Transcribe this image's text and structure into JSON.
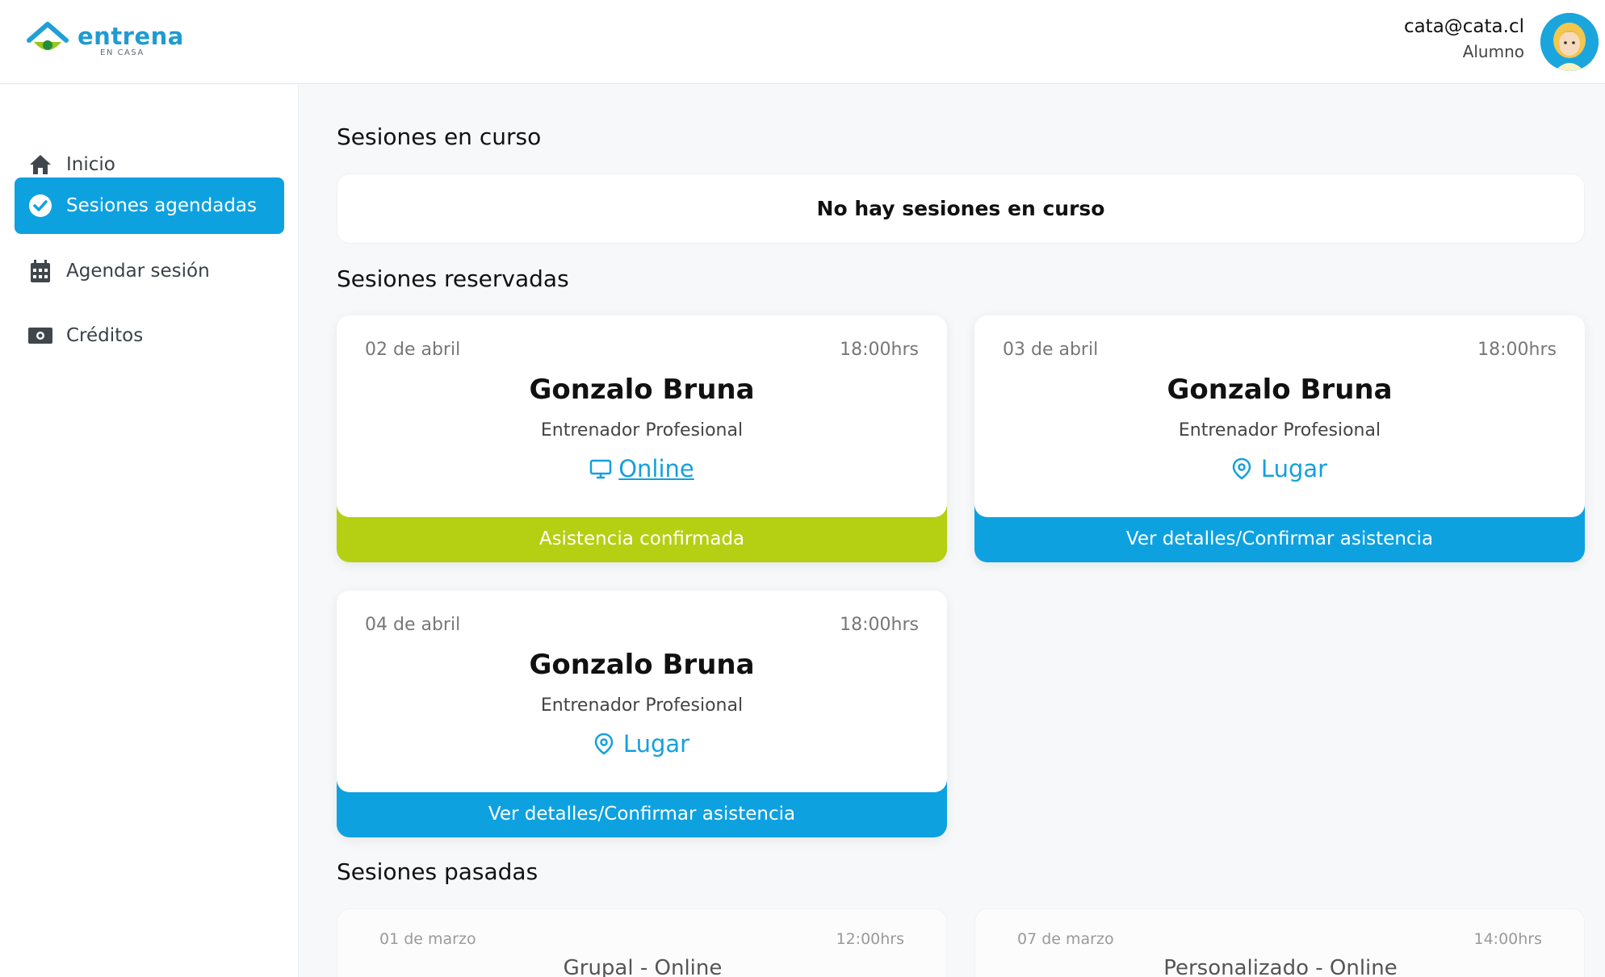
{
  "brand": {
    "name": "entrena",
    "tagline": "EN CASA",
    "colors": {
      "primary": "#0ea1e0",
      "accent": "#b5cf13"
    }
  },
  "user": {
    "email": "cata@cata.cl",
    "role": "Alumno",
    "avatar_icon": "user-avatar"
  },
  "sidebar": {
    "items": [
      {
        "label": "Inicio",
        "icon": "home-icon",
        "active": false
      },
      {
        "label": "Sesiones agendadas",
        "icon": "check-circle-icon",
        "active": true
      },
      {
        "label": "Agendar sesión",
        "icon": "calendar-icon",
        "active": false
      },
      {
        "label": "Créditos",
        "icon": "money-icon",
        "active": false
      }
    ]
  },
  "main": {
    "in_progress": {
      "title": "Sesiones en curso",
      "empty_text": "No hay sesiones en curso"
    },
    "reserved": {
      "title": "Sesiones reservadas",
      "cards": [
        {
          "date": "02 de abril",
          "time": "18:00hrs",
          "name": "Gonzalo Bruna",
          "role": "Entrenador Profesional",
          "location": "Online",
          "location_icon": "monitor-icon",
          "action": "Asistencia confirmada",
          "action_color": "#b5cf13"
        },
        {
          "date": "03 de abril",
          "time": "18:00hrs",
          "name": "Gonzalo Bruna",
          "role": "Entrenador Profesional",
          "location": "Lugar",
          "location_icon": "map-pin-icon",
          "action": "Ver detalles/Confirmar asistencia",
          "action_color": "#0ea1e0"
        },
        {
          "date": "04 de abril",
          "time": "18:00hrs",
          "name": "Gonzalo Bruna",
          "role": "Entrenador Profesional",
          "location": "Lugar",
          "location_icon": "map-pin-icon",
          "action": "Ver detalles/Confirmar asistencia",
          "action_color": "#0ea1e0"
        }
      ]
    },
    "past": {
      "title": "Sesiones pasadas",
      "cards": [
        {
          "date": "01 de marzo",
          "time": "12:00hrs",
          "title": "Grupal - Online"
        },
        {
          "date": "07 de marzo",
          "time": "14:00hrs",
          "title": "Personalizado - Online"
        }
      ]
    }
  }
}
